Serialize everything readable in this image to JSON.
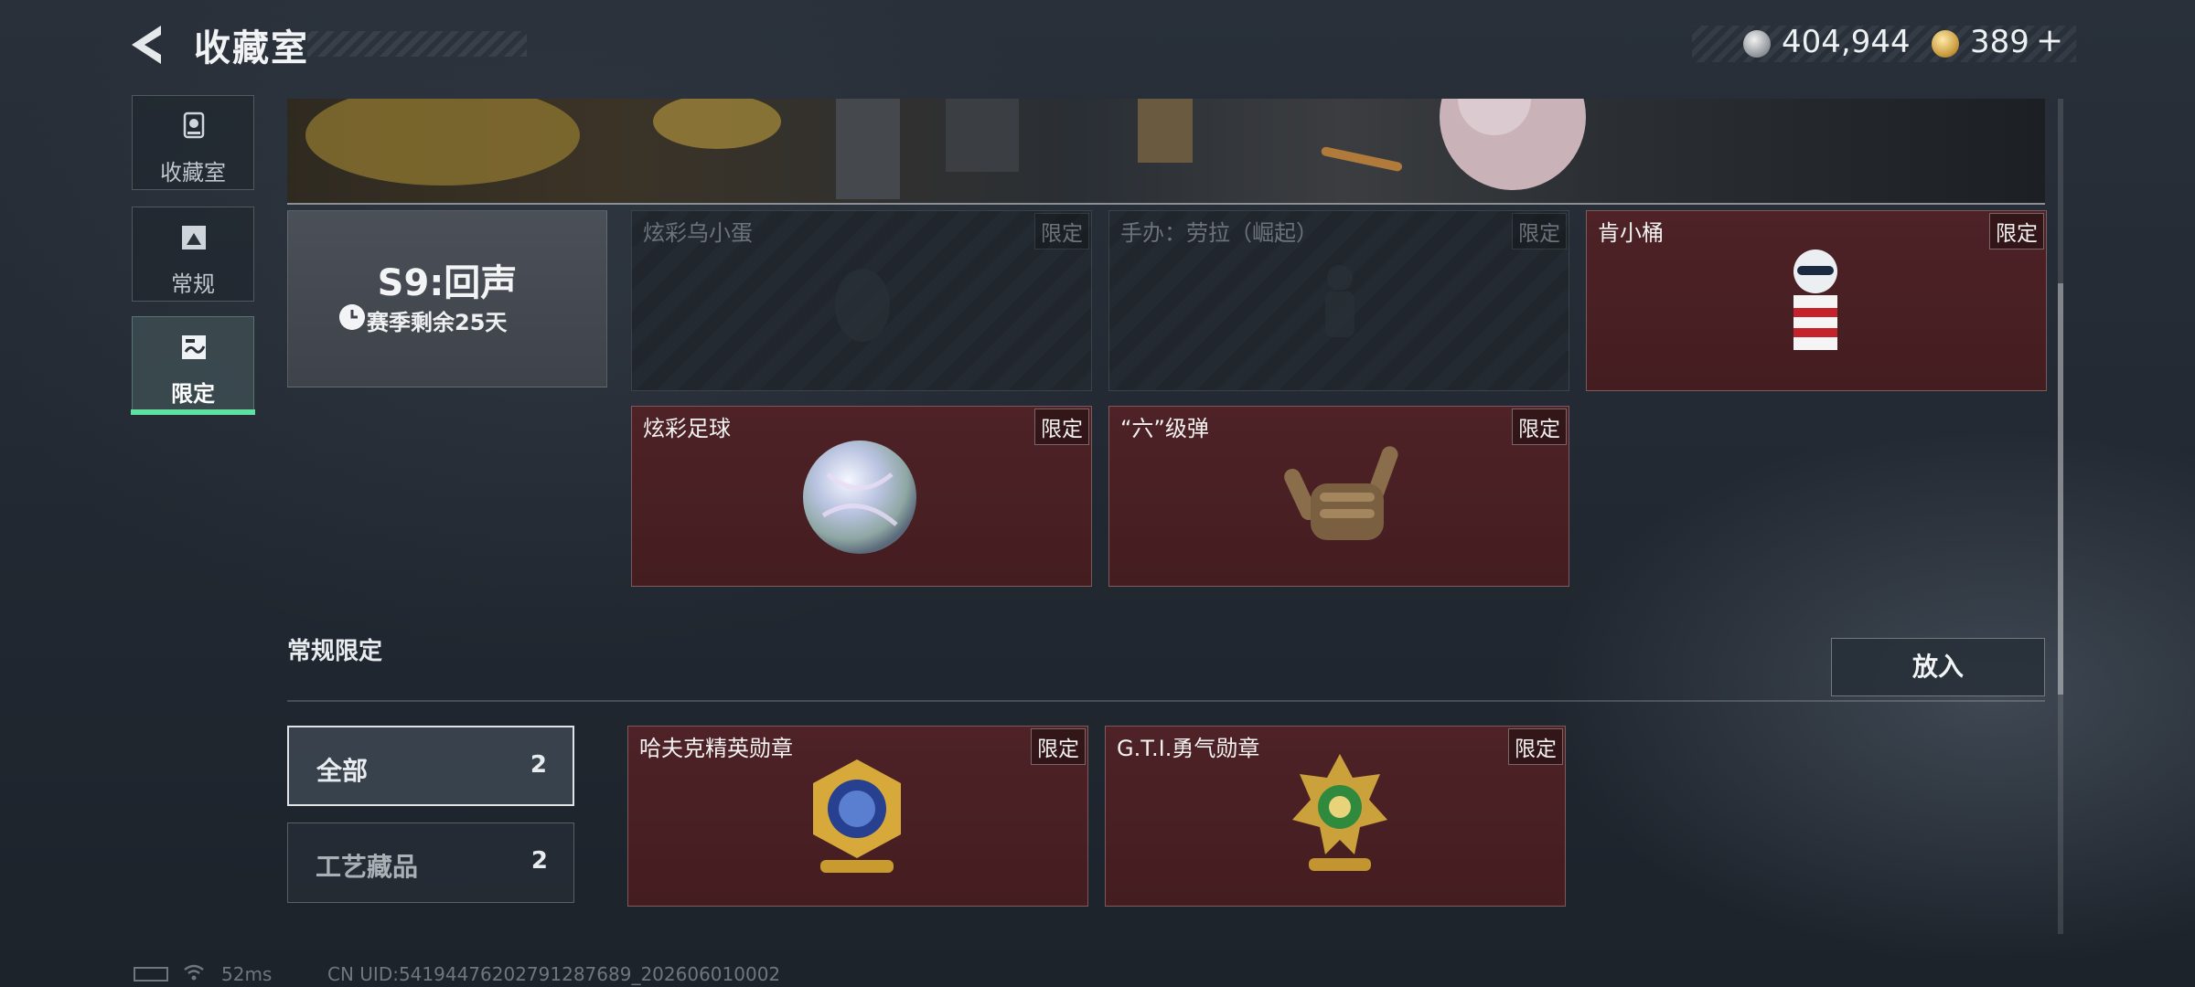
{
  "header": {
    "title": "收藏室",
    "currencies": [
      {
        "icon": "silver-coin-icon",
        "value": "404,944"
      },
      {
        "icon": "gold-coin-icon",
        "value": "389"
      }
    ],
    "add_symbol": "+"
  },
  "sidebar": {
    "items": [
      {
        "label": "收藏室",
        "icon": "trophy-icon",
        "active": false
      },
      {
        "label": "常规",
        "icon": "picture-icon",
        "active": false
      },
      {
        "label": "限定",
        "icon": "limited-icon",
        "active": true
      }
    ]
  },
  "season": {
    "title": "S9:回声",
    "remaining": "赛季剩余25天"
  },
  "season_items": [
    {
      "name": "炫彩乌小蛋",
      "tag": "限定",
      "owned": false
    },
    {
      "name": "手办：劳拉（崛起）",
      "tag": "限定",
      "owned": false
    },
    {
      "name": "肯小桶",
      "tag": "限定",
      "owned": true
    },
    {
      "name": "炫彩足球",
      "tag": "限定",
      "owned": true
    },
    {
      "name": "“六”级弹",
      "tag": "限定",
      "owned": true
    }
  ],
  "regular_section": {
    "title": "常规限定",
    "place_button": "放入",
    "filters": [
      {
        "label": "全部",
        "count": "2",
        "selected": true
      },
      {
        "label": "工艺藏品",
        "count": "2",
        "selected": false
      }
    ],
    "items": [
      {
        "name": "哈夫克精英勋章",
        "tag": "限定"
      },
      {
        "name": "G.T.I.勇气勋章",
        "tag": "限定"
      }
    ]
  },
  "footer": {
    "ping": "52ms",
    "uid": "CN UID:54194476202791287689_202606010002"
  },
  "colors": {
    "owned_card": "#4e2226",
    "accent_green": "#5de0a0"
  }
}
